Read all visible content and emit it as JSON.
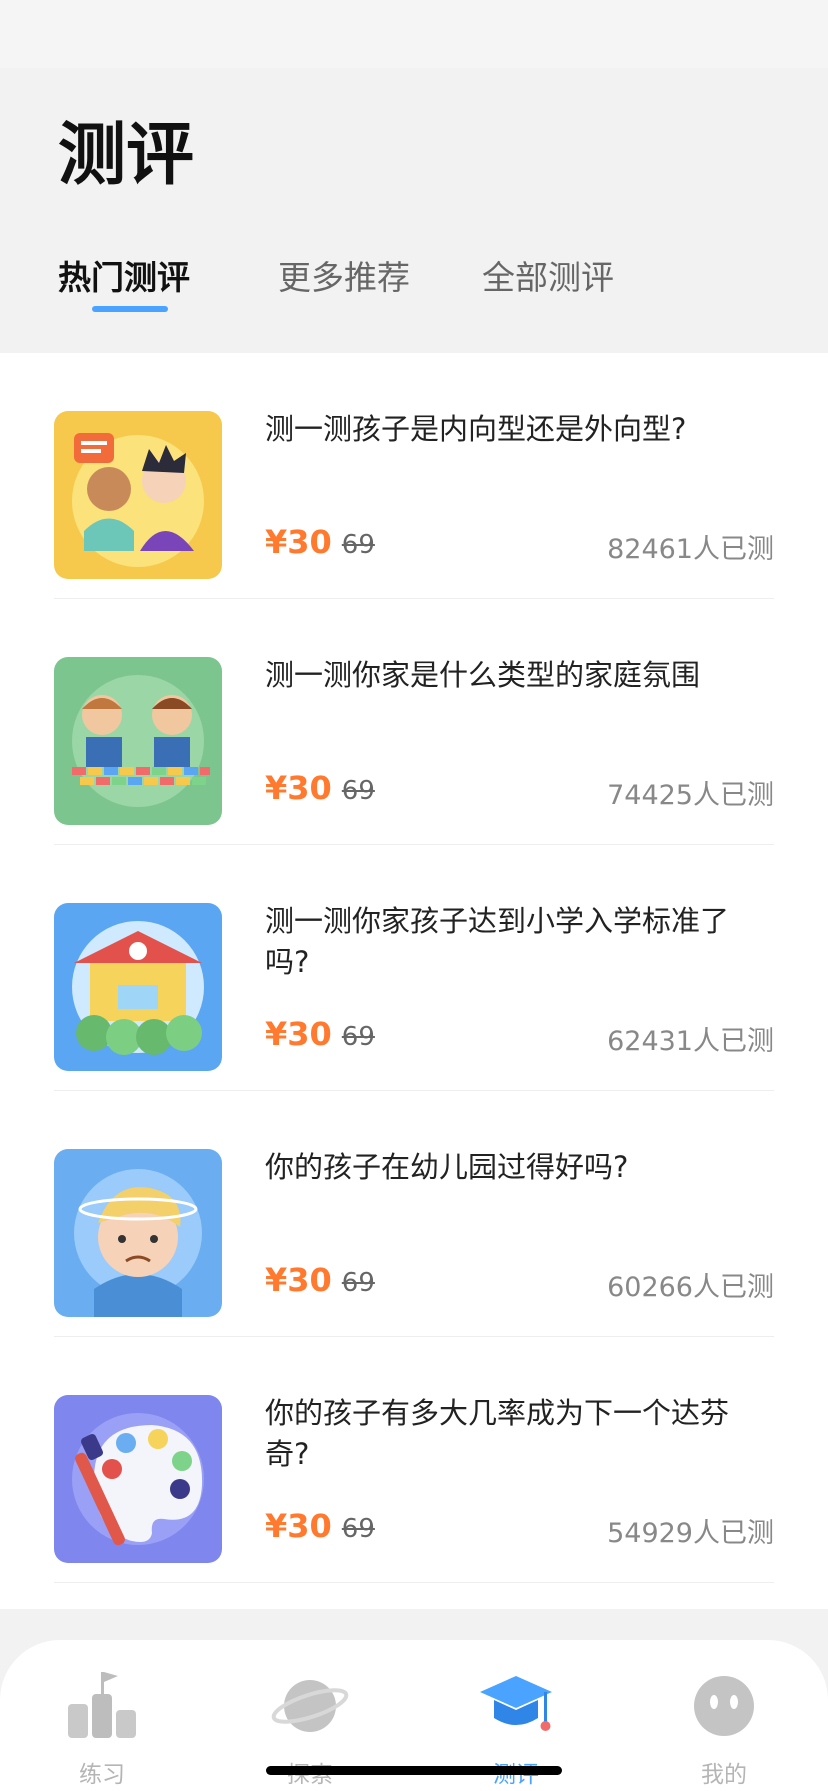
{
  "page": {
    "title": "测评"
  },
  "tabs": [
    {
      "label": "热门测评",
      "active": true
    },
    {
      "label": "更多推荐",
      "active": false
    },
    {
      "label": "全部测评",
      "active": false
    }
  ],
  "items": [
    {
      "title": "测一测孩子是内向型还是外向型?",
      "price": "¥30",
      "original_price": "69",
      "count": "82461人已测",
      "icon": "kids-chatting-icon",
      "bg": "#f6c94d"
    },
    {
      "title": "测一测你家是什么类型的家庭氛围",
      "price": "¥30",
      "original_price": "69",
      "count": "74425人已测",
      "icon": "kids-building-blocks-icon",
      "bg": "#7dc58f"
    },
    {
      "title": "测一测你家孩子达到小学入学标准了吗?",
      "price": "¥30",
      "original_price": "69",
      "count": "62431人已测",
      "icon": "school-house-icon",
      "bg": "#5ba6f2"
    },
    {
      "title": "你的孩子在幼儿园过得好吗?",
      "price": "¥30",
      "original_price": "69",
      "count": "60266人已测",
      "icon": "dizzy-kid-icon",
      "bg": "#6aaef1"
    },
    {
      "title": "你的孩子有多大几率成为下一个达芬奇?",
      "price": "¥30",
      "original_price": "69",
      "count": "54929人已测",
      "icon": "paint-palette-icon",
      "bg": "#7f86ee"
    }
  ],
  "tabbar": [
    {
      "label": "练习",
      "icon": "practice-icon",
      "active": false
    },
    {
      "label": "探索",
      "icon": "planet-icon",
      "active": false
    },
    {
      "label": "测评",
      "icon": "graduation-cap-icon",
      "active": true
    },
    {
      "label": "我的",
      "icon": "profile-icon",
      "active": false
    }
  ],
  "colors": {
    "accent": "#4aa3ff",
    "price": "#ff7a2e"
  }
}
